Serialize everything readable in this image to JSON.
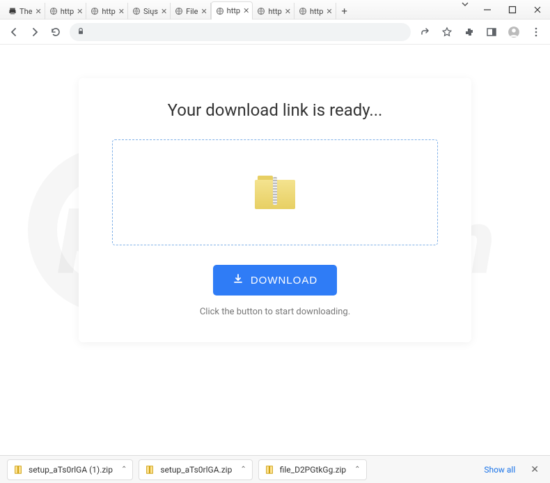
{
  "tabs": [
    {
      "title": "The",
      "favicon": "printer"
    },
    {
      "title": "http",
      "favicon": "globe"
    },
    {
      "title": "http",
      "favicon": "globe"
    },
    {
      "title": "Siųs",
      "favicon": "globe"
    },
    {
      "title": "File",
      "favicon": "globe"
    },
    {
      "title": "http",
      "favicon": "globe",
      "active": true
    },
    {
      "title": "http",
      "favicon": "globe"
    },
    {
      "title": "http",
      "favicon": "globe"
    }
  ],
  "card": {
    "heading": "Your download link is ready...",
    "button_label": "DOWNLOAD",
    "hint": "Click the button to start downloading."
  },
  "downloads": {
    "items": [
      {
        "name": "setup_aTs0rlGA (1).zip"
      },
      {
        "name": "setup_aTs0rlGA.zip"
      },
      {
        "name": "file_D2PGtkGg.zip"
      }
    ],
    "show_all_label": "Show all"
  },
  "watermark": {
    "text": "PCrisk.com"
  }
}
